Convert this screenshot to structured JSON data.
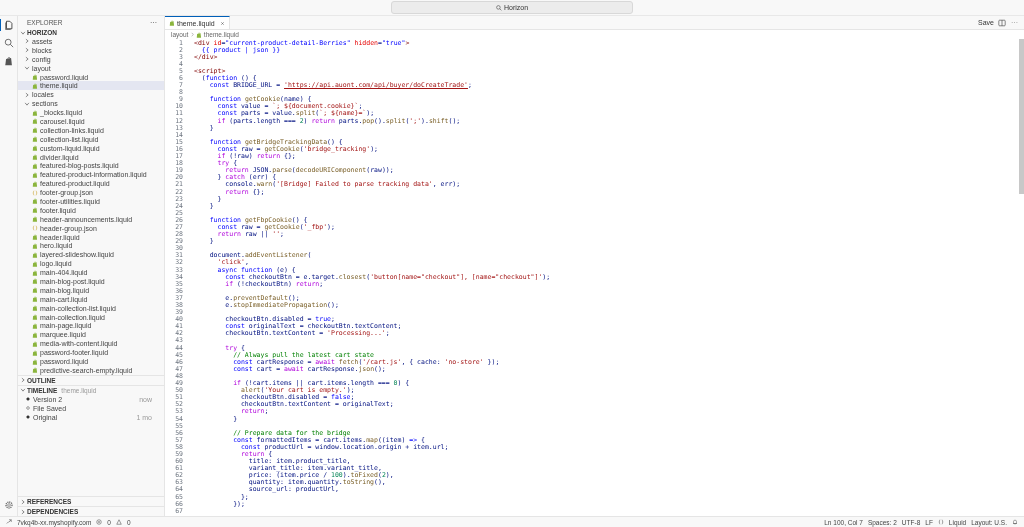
{
  "title_bar": {
    "search": "Horizon"
  },
  "explorer": {
    "title": "EXPLORER",
    "more": "···",
    "root": {
      "label": "HORIZON",
      "expanded": true
    },
    "tree": [
      {
        "label": "assets",
        "kind": "folder",
        "expanded": false,
        "selected": false
      },
      {
        "label": "blocks",
        "kind": "folder",
        "expanded": false,
        "selected": false
      },
      {
        "label": "config",
        "kind": "folder",
        "expanded": false,
        "selected": false
      },
      {
        "label": "layout",
        "kind": "folder",
        "expanded": true,
        "selected": false,
        "children": [
          {
            "label": "password.liquid",
            "kind": "liquid",
            "selected": false
          },
          {
            "label": "theme.liquid",
            "kind": "liquid",
            "selected": true
          }
        ]
      },
      {
        "label": "locales",
        "kind": "folder",
        "expanded": false,
        "selected": false
      },
      {
        "label": "sections",
        "kind": "folder",
        "expanded": true,
        "selected": false,
        "children": [
          {
            "label": "_blocks.liquid",
            "kind": "liquid",
            "selected": false
          },
          {
            "label": "carousel.liquid",
            "kind": "liquid",
            "selected": false
          },
          {
            "label": "collection-links.liquid",
            "kind": "liquid",
            "selected": false
          },
          {
            "label": "collection-list.liquid",
            "kind": "liquid",
            "selected": false
          },
          {
            "label": "custom-liquid.liquid",
            "kind": "liquid",
            "selected": false
          },
          {
            "label": "divider.liquid",
            "kind": "liquid",
            "selected": false
          },
          {
            "label": "featured-blog-posts.liquid",
            "kind": "liquid",
            "selected": false
          },
          {
            "label": "featured-product-information.liquid",
            "kind": "liquid",
            "selected": false
          },
          {
            "label": "featured-product.liquid",
            "kind": "liquid",
            "selected": false
          },
          {
            "label": "footer-group.json",
            "kind": "json",
            "selected": false
          },
          {
            "label": "footer-utilities.liquid",
            "kind": "liquid",
            "selected": false
          },
          {
            "label": "footer.liquid",
            "kind": "liquid",
            "selected": false
          },
          {
            "label": "header-announcements.liquid",
            "kind": "liquid",
            "selected": false
          },
          {
            "label": "header-group.json",
            "kind": "json",
            "selected": false
          },
          {
            "label": "header.liquid",
            "kind": "liquid",
            "selected": false
          },
          {
            "label": "hero.liquid",
            "kind": "liquid",
            "selected": false
          },
          {
            "label": "layered-slideshow.liquid",
            "kind": "liquid",
            "selected": false
          },
          {
            "label": "logo.liquid",
            "kind": "liquid",
            "selected": false
          },
          {
            "label": "main-404.liquid",
            "kind": "liquid",
            "selected": false
          },
          {
            "label": "main-blog-post.liquid",
            "kind": "liquid",
            "selected": false
          },
          {
            "label": "main-blog.liquid",
            "kind": "liquid",
            "selected": false
          },
          {
            "label": "main-cart.liquid",
            "kind": "liquid",
            "selected": false
          },
          {
            "label": "main-collection-list.liquid",
            "kind": "liquid",
            "selected": false
          },
          {
            "label": "main-collection.liquid",
            "kind": "liquid",
            "selected": false
          },
          {
            "label": "main-page.liquid",
            "kind": "liquid",
            "selected": false
          },
          {
            "label": "marquee.liquid",
            "kind": "liquid",
            "selected": false
          },
          {
            "label": "media-with-content.liquid",
            "kind": "liquid",
            "selected": false
          },
          {
            "label": "password-footer.liquid",
            "kind": "liquid",
            "selected": false
          },
          {
            "label": "password.liquid",
            "kind": "liquid",
            "selected": false
          },
          {
            "label": "predictive-search-empty.liquid",
            "kind": "liquid",
            "selected": false
          }
        ]
      }
    ]
  },
  "outline": {
    "label": "OUTLINE",
    "expanded": false
  },
  "timeline": {
    "label": "TIMELINE",
    "file": "theme.liquid",
    "expanded": true,
    "items": [
      {
        "label": "Version 2",
        "time": "now",
        "kind": "filled"
      },
      {
        "label": "File Saved",
        "kind": "hollow"
      },
      {
        "label": "Original",
        "time": "1 mo",
        "kind": "filled"
      }
    ]
  },
  "bottom_sections": [
    {
      "label": "REFERENCES",
      "expanded": false
    },
    {
      "label": "DEPENDENCIES",
      "expanded": false
    }
  ],
  "tabs": [
    {
      "label": "theme.liquid",
      "selected": true
    }
  ],
  "editor_actions": {
    "save": "Save",
    "more": "···"
  },
  "breadcrumb": [
    "layout",
    "theme.liquid"
  ],
  "code": [
    {
      "number": "1",
      "tokens": [
        {
          "kind": "t",
          "text": "<div"
        },
        {
          "kind": "a",
          "text": " id"
        },
        {
          "kind": "p",
          "text": "="
        },
        {
          "kind": "av",
          "text": "\"current-product-detail-Berries\""
        },
        {
          "kind": "a",
          "text": " hidden"
        },
        {
          "kind": "p",
          "text": "="
        },
        {
          "kind": "av",
          "text": "\"true\""
        },
        {
          "kind": "t",
          "text": ">"
        }
      ]
    },
    {
      "number": "2",
      "tokens": [
        {
          "kind": "av",
          "text": "  {{ product | json }}"
        }
      ]
    },
    {
      "number": "3",
      "tokens": [
        {
          "kind": "t",
          "text": "</div>"
        }
      ]
    },
    {
      "number": "4"
    },
    {
      "number": "5",
      "tokens": [
        {
          "kind": "t",
          "text": "<script>"
        }
      ]
    },
    {
      "number": "6",
      "tokens": [
        {
          "kind": "p",
          "text": "  ("
        },
        {
          "kind": "k",
          "text": "function"
        },
        {
          "kind": "p",
          "text": " () {"
        }
      ]
    },
    {
      "number": "7",
      "tokens": [
        {
          "kind": "k",
          "text": "    const"
        },
        {
          "kind": "p",
          "text": " BRIDGE_URL = "
        },
        {
          "kind": "u",
          "text": "'https://api.auont.com/api/buyer/doCreateTrade'"
        },
        {
          "kind": "p",
          "text": ";"
        }
      ]
    },
    {
      "number": "8"
    },
    {
      "number": "9",
      "tokens": [
        {
          "kind": "k",
          "text": "    function"
        },
        {
          "kind": "f",
          "text": " getCookie"
        },
        {
          "kind": "p",
          "text": "(name) {"
        }
      ]
    },
    {
      "number": "10",
      "tokens": [
        {
          "kind": "k",
          "text": "      const"
        },
        {
          "kind": "p",
          "text": " value = "
        },
        {
          "kind": "s",
          "text": "`; ${document.cookie}`"
        },
        {
          "kind": "p",
          "text": ";"
        }
      ]
    },
    {
      "number": "11",
      "tokens": [
        {
          "kind": "k",
          "text": "      const"
        },
        {
          "kind": "p",
          "text": " parts = value."
        },
        {
          "kind": "f",
          "text": "split"
        },
        {
          "kind": "p",
          "text": "("
        },
        {
          "kind": "s",
          "text": "`; ${name}=`"
        },
        {
          "kind": "p",
          "text": ");"
        }
      ]
    },
    {
      "number": "12",
      "tokens": [
        {
          "kind": "c",
          "text": "      if"
        },
        {
          "kind": "p",
          "text": " (parts.length === "
        },
        {
          "kind": "n",
          "text": "2"
        },
        {
          "kind": "p",
          "text": ") "
        },
        {
          "kind": "c",
          "text": "return"
        },
        {
          "kind": "p",
          "text": " parts."
        },
        {
          "kind": "f",
          "text": "pop"
        },
        {
          "kind": "p",
          "text": "()."
        },
        {
          "kind": "f",
          "text": "split"
        },
        {
          "kind": "p",
          "text": "("
        },
        {
          "kind": "s",
          "text": "';'"
        },
        {
          "kind": "p",
          "text": ")."
        },
        {
          "kind": "f",
          "text": "shift"
        },
        {
          "kind": "p",
          "text": "();"
        }
      ]
    },
    {
      "number": "13",
      "tokens": [
        {
          "kind": "p",
          "text": "    }"
        }
      ]
    },
    {
      "number": "14"
    },
    {
      "number": "15",
      "tokens": [
        {
          "kind": "k",
          "text": "    function"
        },
        {
          "kind": "f",
          "text": " getBridgeTrackingData"
        },
        {
          "kind": "p",
          "text": "() {"
        }
      ]
    },
    {
      "number": "16",
      "tokens": [
        {
          "kind": "k",
          "text": "      const"
        },
        {
          "kind": "p",
          "text": " raw = "
        },
        {
          "kind": "f",
          "text": "getCookie"
        },
        {
          "kind": "p",
          "text": "("
        },
        {
          "kind": "s",
          "text": "'bridge_tracking'"
        },
        {
          "kind": "p",
          "text": ");"
        }
      ]
    },
    {
      "number": "17",
      "tokens": [
        {
          "kind": "c",
          "text": "      if"
        },
        {
          "kind": "p",
          "text": " (!raw) "
        },
        {
          "kind": "c",
          "text": "return"
        },
        {
          "kind": "p",
          "text": " {};"
        }
      ]
    },
    {
      "number": "18",
      "tokens": [
        {
          "kind": "c",
          "text": "      try"
        },
        {
          "kind": "p",
          "text": " {"
        }
      ]
    },
    {
      "number": "19",
      "tokens": [
        {
          "kind": "c",
          "text": "        return"
        },
        {
          "kind": "p",
          "text": " JSON."
        },
        {
          "kind": "f",
          "text": "parse"
        },
        {
          "kind": "p",
          "text": "("
        },
        {
          "kind": "f",
          "text": "decodeURIComponent"
        },
        {
          "kind": "p",
          "text": "(raw));"
        }
      ]
    },
    {
      "number": "20",
      "tokens": [
        {
          "kind": "p",
          "text": "      } "
        },
        {
          "kind": "c",
          "text": "catch"
        },
        {
          "kind": "p",
          "text": " (err) {"
        }
      ]
    },
    {
      "number": "21",
      "tokens": [
        {
          "kind": "p",
          "text": "        console."
        },
        {
          "kind": "f",
          "text": "warn"
        },
        {
          "kind": "p",
          "text": "("
        },
        {
          "kind": "s",
          "text": "'[Bridge] Failed to parse tracking data'"
        },
        {
          "kind": "p",
          "text": ", err);"
        }
      ]
    },
    {
      "number": "22",
      "tokens": [
        {
          "kind": "c",
          "text": "        return"
        },
        {
          "kind": "p",
          "text": " {};"
        }
      ]
    },
    {
      "number": "23",
      "tokens": [
        {
          "kind": "p",
          "text": "      }"
        }
      ]
    },
    {
      "number": "24",
      "tokens": [
        {
          "kind": "p",
          "text": "    }"
        }
      ]
    },
    {
      "number": "25"
    },
    {
      "number": "26",
      "tokens": [
        {
          "kind": "k",
          "text": "    function"
        },
        {
          "kind": "f",
          "text": " getFbpCookie"
        },
        {
          "kind": "p",
          "text": "() {"
        }
      ]
    },
    {
      "number": "27",
      "tokens": [
        {
          "kind": "k",
          "text": "      const"
        },
        {
          "kind": "p",
          "text": " raw = "
        },
        {
          "kind": "f",
          "text": "getCookie"
        },
        {
          "kind": "p",
          "text": "("
        },
        {
          "kind": "s",
          "text": "'_fbp'"
        },
        {
          "kind": "p",
          "text": ");"
        }
      ]
    },
    {
      "number": "28",
      "tokens": [
        {
          "kind": "c",
          "text": "      return"
        },
        {
          "kind": "p",
          "text": " raw || "
        },
        {
          "kind": "s",
          "text": "''"
        },
        {
          "kind": "p",
          "text": ";"
        }
      ]
    },
    {
      "number": "29",
      "tokens": [
        {
          "kind": "p",
          "text": "    }"
        }
      ]
    },
    {
      "number": "30"
    },
    {
      "number": "31",
      "tokens": [
        {
          "kind": "p",
          "text": "    document."
        },
        {
          "kind": "f",
          "text": "addEventListener"
        },
        {
          "kind": "p",
          "text": "("
        }
      ]
    },
    {
      "number": "32",
      "tokens": [
        {
          "kind": "s",
          "text": "      'click'"
        },
        {
          "kind": "p",
          "text": ","
        }
      ]
    },
    {
      "number": "33",
      "tokens": [
        {
          "kind": "k",
          "text": "      async function"
        },
        {
          "kind": "p",
          "text": " (e) {"
        }
      ]
    },
    {
      "number": "34",
      "tokens": [
        {
          "kind": "k",
          "text": "        const"
        },
        {
          "kind": "p",
          "text": " checkoutBtn = e.target."
        },
        {
          "kind": "f",
          "text": "closest"
        },
        {
          "kind": "p",
          "text": "("
        },
        {
          "kind": "s",
          "text": "'button[name=\"checkout\"], [name=\"checkout\"]'"
        },
        {
          "kind": "p",
          "text": ");"
        }
      ]
    },
    {
      "number": "35",
      "tokens": [
        {
          "kind": "c",
          "text": "        if"
        },
        {
          "kind": "p",
          "text": " (!checkoutBtn) "
        },
        {
          "kind": "c",
          "text": "return"
        },
        {
          "kind": "p",
          "text": ";"
        }
      ]
    },
    {
      "number": "36"
    },
    {
      "number": "37",
      "tokens": [
        {
          "kind": "p",
          "text": "        e."
        },
        {
          "kind": "f",
          "text": "preventDefault"
        },
        {
          "kind": "p",
          "text": "();"
        }
      ]
    },
    {
      "number": "38",
      "tokens": [
        {
          "kind": "p",
          "text": "        e."
        },
        {
          "kind": "f",
          "text": "stopImmediatePropagation"
        },
        {
          "kind": "p",
          "text": "();"
        }
      ]
    },
    {
      "number": "39"
    },
    {
      "number": "40",
      "tokens": [
        {
          "kind": "p",
          "text": "        checkoutBtn.disabled = "
        },
        {
          "kind": "k",
          "text": "true"
        },
        {
          "kind": "p",
          "text": ";"
        }
      ]
    },
    {
      "number": "41",
      "tokens": [
        {
          "kind": "k",
          "text": "        const"
        },
        {
          "kind": "p",
          "text": " originalText = checkoutBtn.textContent;"
        }
      ]
    },
    {
      "number": "42",
      "tokens": [
        {
          "kind": "p",
          "text": "        checkoutBtn.textContent = "
        },
        {
          "kind": "s",
          "text": "'Processing...'"
        },
        {
          "kind": "p",
          "text": ";"
        }
      ]
    },
    {
      "number": "43"
    },
    {
      "number": "44",
      "tokens": [
        {
          "kind": "c",
          "text": "        try"
        },
        {
          "kind": "p",
          "text": " {"
        }
      ]
    },
    {
      "number": "45",
      "tokens": [
        {
          "kind": "m",
          "text": "          // Always pull the latest cart state"
        }
      ]
    },
    {
      "number": "46",
      "tokens": [
        {
          "kind": "k",
          "text": "          const"
        },
        {
          "kind": "p",
          "text": " cartResponse = "
        },
        {
          "kind": "c",
          "text": "await"
        },
        {
          "kind": "f",
          "text": " fetch"
        },
        {
          "kind": "p",
          "text": "("
        },
        {
          "kind": "s",
          "text": "'/cart.js'"
        },
        {
          "kind": "p",
          "text": ", { cache: "
        },
        {
          "kind": "s",
          "text": "'no-store'"
        },
        {
          "kind": "p",
          "text": " });"
        }
      ]
    },
    {
      "number": "47",
      "tokens": [
        {
          "kind": "k",
          "text": "          const"
        },
        {
          "kind": "p",
          "text": " cart = "
        },
        {
          "kind": "c",
          "text": "await"
        },
        {
          "kind": "p",
          "text": " cartResponse."
        },
        {
          "kind": "f",
          "text": "json"
        },
        {
          "kind": "p",
          "text": "();"
        }
      ]
    },
    {
      "number": "48"
    },
    {
      "number": "49",
      "tokens": [
        {
          "kind": "c",
          "text": "          if"
        },
        {
          "kind": "p",
          "text": " (!cart.items || cart.items.length === "
        },
        {
          "kind": "n",
          "text": "0"
        },
        {
          "kind": "p",
          "text": ") {"
        }
      ]
    },
    {
      "number": "50",
      "tokens": [
        {
          "kind": "f",
          "text": "            alert"
        },
        {
          "kind": "p",
          "text": "("
        },
        {
          "kind": "s",
          "text": "'Your cart is empty.'"
        },
        {
          "kind": "p",
          "text": ");"
        }
      ]
    },
    {
      "number": "51",
      "tokens": [
        {
          "kind": "p",
          "text": "            checkoutBtn.disabled = "
        },
        {
          "kind": "k",
          "text": "false"
        },
        {
          "kind": "p",
          "text": ";"
        }
      ]
    },
    {
      "number": "52",
      "tokens": [
        {
          "kind": "p",
          "text": "            checkoutBtn.textContent = originalText;"
        }
      ]
    },
    {
      "number": "53",
      "tokens": [
        {
          "kind": "c",
          "text": "            return"
        },
        {
          "kind": "p",
          "text": ";"
        }
      ]
    },
    {
      "number": "54",
      "tokens": [
        {
          "kind": "p",
          "text": "          }"
        }
      ]
    },
    {
      "number": "55"
    },
    {
      "number": "56",
      "tokens": [
        {
          "kind": "m",
          "text": "          // Prepare data for the bridge"
        }
      ]
    },
    {
      "number": "57",
      "tokens": [
        {
          "kind": "k",
          "text": "          const"
        },
        {
          "kind": "p",
          "text": " formattedItems = cart.items."
        },
        {
          "kind": "f",
          "text": "map"
        },
        {
          "kind": "p",
          "text": "((item) "
        },
        {
          "kind": "k",
          "text": "=>"
        },
        {
          "kind": "p",
          "text": " {"
        }
      ]
    },
    {
      "number": "58",
      "tokens": [
        {
          "kind": "k",
          "text": "            const"
        },
        {
          "kind": "p",
          "text": " productUrl = window.location.origin + item.url;"
        }
      ]
    },
    {
      "number": "59",
      "tokens": [
        {
          "kind": "c",
          "text": "            return"
        },
        {
          "kind": "p",
          "text": " {"
        }
      ]
    },
    {
      "number": "60",
      "tokens": [
        {
          "kind": "p",
          "text": "              title: item.product_title,"
        }
      ]
    },
    {
      "number": "61",
      "tokens": [
        {
          "kind": "p",
          "text": "              variant_title: item.variant_title,"
        }
      ]
    },
    {
      "number": "62",
      "tokens": [
        {
          "kind": "p",
          "text": "              price: (item.price / "
        },
        {
          "kind": "n",
          "text": "100"
        },
        {
          "kind": "p",
          "text": ")."
        },
        {
          "kind": "f",
          "text": "toFixed"
        },
        {
          "kind": "p",
          "text": "("
        },
        {
          "kind": "n",
          "text": "2"
        },
        {
          "kind": "p",
          "text": "),"
        }
      ]
    },
    {
      "number": "63",
      "tokens": [
        {
          "kind": "p",
          "text": "              quantity: item.quantity."
        },
        {
          "kind": "f",
          "text": "toString"
        },
        {
          "kind": "p",
          "text": "(),"
        }
      ]
    },
    {
      "number": "64",
      "tokens": [
        {
          "kind": "p",
          "text": "              source_url: productUrl,"
        }
      ]
    },
    {
      "number": "65",
      "tokens": [
        {
          "kind": "p",
          "text": "            };"
        }
      ]
    },
    {
      "number": "66",
      "tokens": [
        {
          "kind": "p",
          "text": "          });"
        }
      ]
    },
    {
      "number": "67"
    }
  ],
  "status_bar": {
    "remote": "7vkq4b-xx.myshopify.com",
    "errors": "0",
    "warnings": "0",
    "position": "Ln 100, Col 7",
    "spaces": "Spaces: 2",
    "encoding": "UTF-8",
    "eol": "LF",
    "language": "Liquid",
    "layout": "Layout: U.S."
  }
}
